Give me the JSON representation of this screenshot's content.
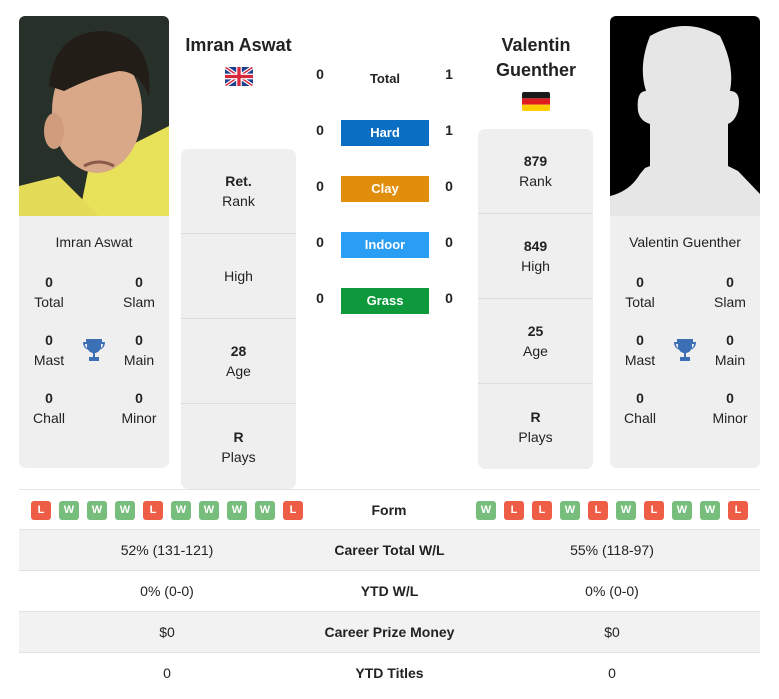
{
  "player1": {
    "name": "Imran Aswat",
    "country_flag": "uk-flag",
    "photo": "player-photo",
    "titles": [
      {
        "value": "0",
        "label": "Total"
      },
      {
        "value": "0",
        "label": "Slam"
      },
      {
        "value": "0",
        "label": "Mast"
      },
      {
        "value": "0",
        "label": "Main"
      },
      {
        "value": "0",
        "label": "Chall"
      },
      {
        "value": "0",
        "label": "Minor"
      }
    ],
    "stats": [
      {
        "value": "Ret.",
        "label": "Rank"
      },
      {
        "value": "",
        "label": "High"
      },
      {
        "value": "28",
        "label": "Age"
      },
      {
        "value": "R",
        "label": "Plays"
      }
    ],
    "form": [
      "L",
      "W",
      "W",
      "W",
      "L",
      "W",
      "W",
      "W",
      "W",
      "L"
    ]
  },
  "player2": {
    "name_line1": "Valentin",
    "name_line2": "Guenther",
    "name": "Valentin Guenther",
    "country_flag": "germany-flag",
    "photo": "silhouette-placeholder",
    "titles": [
      {
        "value": "0",
        "label": "Total"
      },
      {
        "value": "0",
        "label": "Slam"
      },
      {
        "value": "0",
        "label": "Mast"
      },
      {
        "value": "0",
        "label": "Main"
      },
      {
        "value": "0",
        "label": "Chall"
      },
      {
        "value": "0",
        "label": "Minor"
      }
    ],
    "stats": [
      {
        "value": "879",
        "label": "Rank"
      },
      {
        "value": "849",
        "label": "High"
      },
      {
        "value": "25",
        "label": "Age"
      },
      {
        "value": "R",
        "label": "Plays"
      }
    ],
    "form": [
      "W",
      "L",
      "L",
      "W",
      "L",
      "W",
      "L",
      "W",
      "W",
      "L"
    ]
  },
  "h2h": [
    {
      "label": "Total",
      "p1": "0",
      "p2": "1",
      "color": ""
    },
    {
      "label": "Hard",
      "p1": "0",
      "p2": "1",
      "color": "#0a6fc2"
    },
    {
      "label": "Clay",
      "p1": "0",
      "p2": "0",
      "color": "#e08e0b"
    },
    {
      "label": "Indoor",
      "p1": "0",
      "p2": "0",
      "color": "#2a9df4"
    },
    {
      "label": "Grass",
      "p1": "0",
      "p2": "0",
      "color": "#0e9a3c"
    }
  ],
  "comparison": {
    "form_label": "Form",
    "rows": [
      {
        "label": "Career Total W/L",
        "p1": "52% (131-121)",
        "p2": "55% (118-97)"
      },
      {
        "label": "YTD W/L",
        "p1": "0% (0-0)",
        "p2": "0% (0-0)"
      },
      {
        "label": "Career Prize Money",
        "p1": "$0",
        "p2": "$0"
      },
      {
        "label": "YTD Titles",
        "p1": "0",
        "p2": "0"
      }
    ]
  },
  "colors": {
    "win": "#77bd7c",
    "loss": "#ee5d45",
    "trophy": "#3b6fb6",
    "card_bg": "#efefef"
  }
}
